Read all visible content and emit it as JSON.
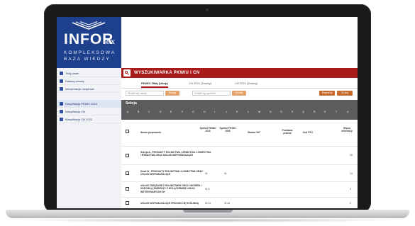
{
  "brand": {
    "title": "INFOR",
    "tex": "lex",
    "line1": "KOMPLEKSOWA",
    "line2": "BAZA WIEDZY"
  },
  "sidebar": {
    "items": [
      {
        "label": "Twój panel",
        "icon": "home-icon"
      },
      {
        "label": "Katalog wiedzy",
        "icon": "book-icon"
      },
      {
        "label": "Interpretacje urzędowe",
        "icon": "document-icon"
      },
      {
        "label": "Klasyfikacja PKWiU 2015",
        "icon": "list-icon",
        "active": true
      },
      {
        "label": "Klasyfikacja CN",
        "icon": "list-icon"
      },
      {
        "label": "Klasyfikacja CN 2022",
        "icon": "list-icon"
      }
    ]
  },
  "header": {
    "title": "WYSZUKIWARKA PKWIU I CN",
    "search_icon": "search-icon"
  },
  "tabs": [
    {
      "label": "PKWiU ZMaj (Urlop)",
      "active": true
    },
    {
      "label": "CN 2022 (Towary)"
    },
    {
      "label": "CN 2022 (Towary)"
    }
  ],
  "filters": {
    "search1_placeholder": "Znajdź wg nazwy",
    "search1_button": "Szukaj",
    "search2_placeholder": "Znajdź wg symbolu",
    "search2_button": "Szukaj",
    "action1": "Eksportuj",
    "action2": "Drukuj"
  },
  "table": {
    "section_title": "Sekcja",
    "letters": [
      "A",
      "B",
      "C",
      "D",
      "E",
      "F",
      "G",
      "H",
      "I",
      "J",
      "K",
      "L",
      "M",
      "N",
      "O",
      "P",
      "Q",
      "R",
      "S",
      "T",
      "U"
    ],
    "columns": {
      "name": "Nazwa grupowania",
      "sym2015": "Symbol PKWiU 2015",
      "sym2008": "Symbol PKWiU 2008",
      "vat": "Stawka VAT",
      "legal": "Podstawa prawna",
      "kod": "Kod GTU",
      "extra": "Więcej informacji"
    },
    "rows": [
      {
        "desc": "Sekcja A - PRODUKTY ROLNICTWA, LEŚNICTWA, ŁOWIECTWA I RYBACTWA ORAZ USŁUGI WSPOMAGAJĄCE",
        "sym2015": "",
        "sym2008": "",
        "count": "15"
      },
      {
        "desc": "Dział 01 - PRODUKTY ROLNICTWA I ŁOWIECTWA ORAZ USŁUGI WSPOMAGAJĄCE",
        "sym2015": "01",
        "sym2008": "01",
        "count": "14"
      },
      {
        "desc": "USŁUGI ZWIĄZANE Z ROLNICTWEM ORAZ CHOWEM I HODOWLĄ ZWIERZĄT, Z WYŁĄCZENIEM USŁUG WETERYNARYJNYCH",
        "sym2015": "01.6",
        "sym2008": "",
        "count": "3"
      },
      {
        "desc": "USŁUGI WSPOMAGAJĄCE PRODUKCJĘ ROŚLINNĄ",
        "sym2015": "01.61",
        "sym2008": "01.61",
        "count": "2"
      }
    ]
  }
}
